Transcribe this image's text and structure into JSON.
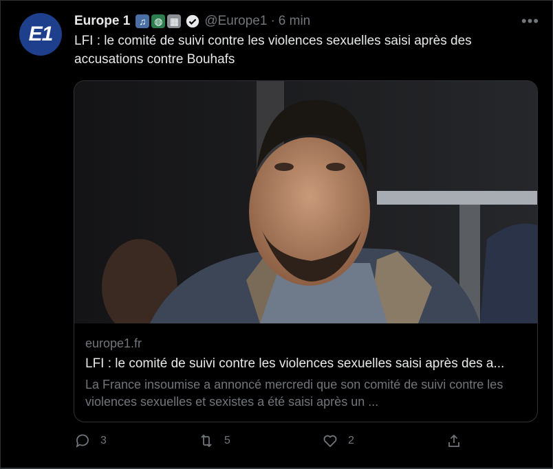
{
  "tweet": {
    "author_name": "Europe 1",
    "avatar_text": "E1",
    "handle": "@Europe1",
    "separator": "·",
    "time": "6 min",
    "text": "LFI : le comité de suivi contre les violences sexuelles saisi après des accusations contre Bouhafs"
  },
  "card": {
    "domain": "europe1.fr",
    "title": "LFI : le comité de suivi contre les violences sexuelles saisi après des a...",
    "description": "La France insoumise a annoncé mercredi que son comité de suivi contre les violences sexuelles et sexistes a été saisi après un ..."
  },
  "actions": {
    "replies": "3",
    "retweets": "5",
    "likes": "2"
  },
  "icons": [
    "music-note-icon",
    "globe-icon",
    "radio-icon",
    "verified-badge-icon",
    "more-icon",
    "reply-icon",
    "retweet-icon",
    "like-icon",
    "share-icon"
  ],
  "colors": {
    "background": "#000000",
    "text": "#e7e9ea",
    "muted": "#71767b",
    "border": "#2f3336",
    "avatar": "#1d3f8c"
  }
}
